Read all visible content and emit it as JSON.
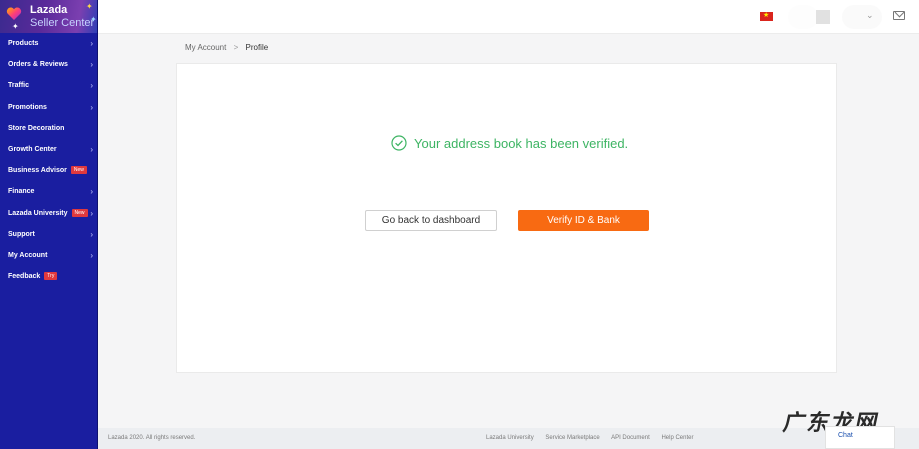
{
  "brand": {
    "name": "Lazada",
    "subtitle": "Seller Center"
  },
  "sidebar": {
    "items": [
      {
        "label": "Products",
        "has_chevron": true,
        "badge": ""
      },
      {
        "label": "Orders & Reviews",
        "has_chevron": true,
        "badge": ""
      },
      {
        "label": "Traffic",
        "has_chevron": true,
        "badge": ""
      },
      {
        "label": "Promotions",
        "has_chevron": true,
        "badge": ""
      },
      {
        "label": "Store Decoration",
        "has_chevron": false,
        "badge": ""
      },
      {
        "label": "Growth Center",
        "has_chevron": true,
        "badge": ""
      },
      {
        "label": "Business Advisor",
        "has_chevron": false,
        "badge": "New"
      },
      {
        "label": "Finance",
        "has_chevron": true,
        "badge": ""
      },
      {
        "label": "Lazada University",
        "has_chevron": true,
        "badge": "New"
      },
      {
        "label": "Support",
        "has_chevron": true,
        "badge": ""
      },
      {
        "label": "My Account",
        "has_chevron": true,
        "badge": ""
      },
      {
        "label": "Feedback",
        "has_chevron": false,
        "badge": "Try"
      }
    ],
    "chevron": "›"
  },
  "header": {
    "icons": [
      "vietnam-flag-icon",
      "avatar",
      "chevron-down-icon",
      "mail-icon"
    ]
  },
  "breadcrumb": {
    "parent": "My Account",
    "separator": ">",
    "current": "Profile"
  },
  "main": {
    "status_message": "Your address book has been verified.",
    "back_button": "Go back to dashboard",
    "verify_button": "Verify ID & Bank"
  },
  "footer": {
    "copyright": "Lazada 2020. All rights reserved.",
    "links": [
      "Lazada University",
      "Service Marketplace",
      "API Document",
      "Help Center"
    ]
  },
  "chat": {
    "label": "Chat"
  },
  "watermark": {
    "text": "广东龙网"
  },
  "colors": {
    "sidebar_bg": "#1a1ea0",
    "accent_orange": "#f86a12",
    "success_green": "#3db463",
    "badge_red": "#e0393e"
  }
}
